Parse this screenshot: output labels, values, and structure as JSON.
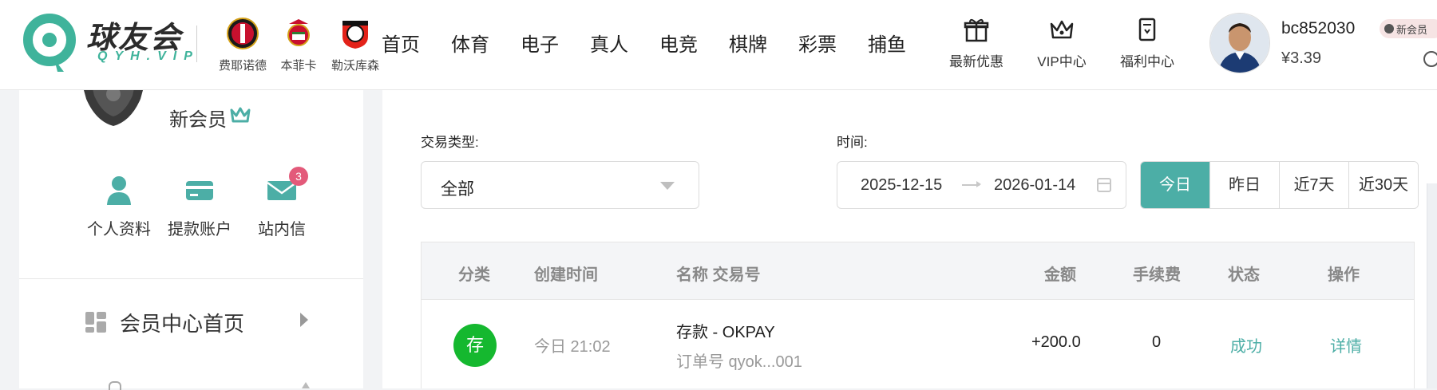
{
  "header": {
    "logo_text": "球友会",
    "logo_sub": "QYH.VIP",
    "clubs": [
      {
        "name": "费耶诺德",
        "icon": "feyenoord-badge-icon"
      },
      {
        "name": "本菲卡",
        "icon": "benfica-badge-icon"
      },
      {
        "name": "勒沃库森",
        "icon": "leverkusen-badge-icon"
      }
    ],
    "nav": [
      "首页",
      "体育",
      "电子",
      "真人",
      "电竞",
      "棋牌",
      "彩票",
      "捕鱼"
    ],
    "icon_nav": [
      {
        "label": "最新优惠",
        "icon": "gift-icon"
      },
      {
        "label": "VIP中心",
        "icon": "crown-icon"
      },
      {
        "label": "福利中心",
        "icon": "document-icon"
      }
    ],
    "user": {
      "username": "bc852030",
      "balance": "¥3.39",
      "level_badge": "新会员"
    }
  },
  "sidebar": {
    "member_level": "新会员",
    "quick_links": [
      {
        "label": "个人资料",
        "icon": "user-icon"
      },
      {
        "label": "提款账户",
        "icon": "card-icon"
      },
      {
        "label": "站内信",
        "icon": "mail-icon",
        "badge": "3"
      }
    ],
    "menu": [
      {
        "label": "会员中心首页",
        "icon": "dashboard-icon"
      }
    ]
  },
  "filters": {
    "type_label": "交易类型:",
    "type_value": "全部",
    "time_label": "时间:",
    "date_start": "2025-12-15",
    "date_end": "2026-01-14",
    "quick_dates": [
      "今日",
      "昨日",
      "近7天",
      "近30天"
    ],
    "active_quick_date": "今日"
  },
  "table": {
    "headers": [
      "分类",
      "创建时间",
      "名称 交易号",
      "金额",
      "手续费",
      "状态",
      "操作"
    ],
    "rows": [
      {
        "category": "存",
        "created": "今日 21:02",
        "name": "存款 - OKPAY",
        "order": "订单号 qyok...001",
        "amount": "+200.0",
        "fee": "0",
        "status": "成功",
        "action": "详情"
      }
    ]
  },
  "colors": {
    "accent": "#4caea6",
    "deposit": "#15b82f",
    "badge": "#e35a7a"
  }
}
